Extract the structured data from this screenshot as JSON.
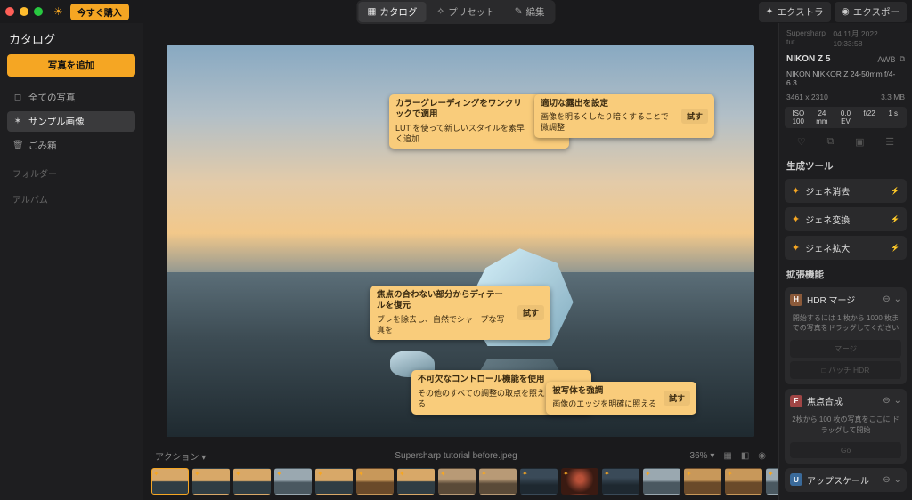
{
  "topbar": {
    "buy_label": "今すぐ購入",
    "tabs": {
      "catalog": "カタログ",
      "presets": "プリセット",
      "edit": "編集"
    },
    "extras": "エクストラ",
    "export": "エクスポー"
  },
  "sidebar": {
    "title": "カタログ",
    "add_photos": "写真を追加",
    "all": "全ての写真",
    "samples": "サンプル画像",
    "trash": "ごみ箱",
    "folders": "フォルダー",
    "albums": "アルバム"
  },
  "tips": {
    "t1": {
      "title": "カラーグレーディングをワンクリックで適用",
      "desc": "LUT を使って新しいスタイルを素早く追加"
    },
    "t2": {
      "title": "適切な露出を設定",
      "desc": "画像を明るくしたり暗くすることで微調整"
    },
    "t3": {
      "title": "焦点の合わない部分からディテールを復元",
      "desc": "ブレを除去し、自然でシャープな写真を"
    },
    "t4": {
      "title": "不可欠なコントロール機能を使用",
      "desc": "その他のすべての調整の取点を照える"
    },
    "t5": {
      "title": "被写体を強調",
      "desc": "画像のエッジを明確に照える"
    },
    "try": "試す"
  },
  "canvas_footer": {
    "actions": "アクション",
    "filename": "Supersharp tutorial before.jpeg",
    "zoom": "36%"
  },
  "meta": {
    "file": "Supersharp tut",
    "datetime": "04 11月 2022 10:33:58",
    "camera": "NIKON Z 5",
    "wb": "AWB",
    "lens": "NIKON NIKKOR Z 24-50mm f/4-6.3",
    "dims": "3461 x 2310",
    "size": "3.3 MB",
    "iso": "ISO 100",
    "focal": "24 mm",
    "ev": "0.0 EV",
    "aperture": "f/22",
    "shutter": "1 s"
  },
  "gen": {
    "title": "生成ツール",
    "erase": "ジェネ消去",
    "swap": "ジェネ変換",
    "expand": "ジェネ拡大"
  },
  "ext": {
    "title": "拡張機能",
    "hdr": {
      "label": "HDR マージ",
      "desc": "開始するには 1 枚から 1000 枚までの写真をドラッグしてください",
      "merge": "マージ",
      "batch": "□ バッチ HDR"
    },
    "focus": {
      "label": "焦点合成",
      "desc": "2枚から 100 枚の写真をここに ドラッグして開始",
      "go": "Go"
    },
    "upscale": {
      "label": "アップスケール"
    }
  }
}
